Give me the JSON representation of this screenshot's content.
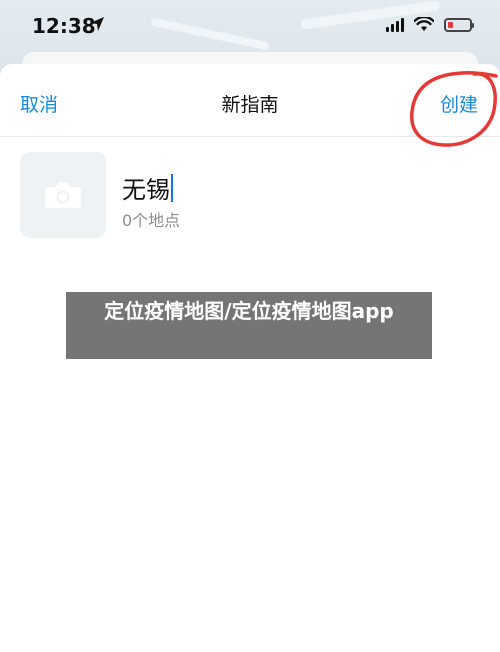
{
  "status_bar": {
    "time": "12:38",
    "location_icon": "location-arrow-icon",
    "battery_level": 0.25
  },
  "nav": {
    "cancel_label": "取消",
    "title": "新指南",
    "create_label": "创建"
  },
  "guide": {
    "name": "无锡",
    "place_count": "0个地点",
    "photo_icon": "camera-icon"
  },
  "overlay": {
    "text": "定位疫情地图/定位疫情地图app"
  },
  "colors": {
    "accent": "#1a8ad8",
    "annotation_red": "#e53935",
    "overlay_bg": "#6e6e6e"
  }
}
